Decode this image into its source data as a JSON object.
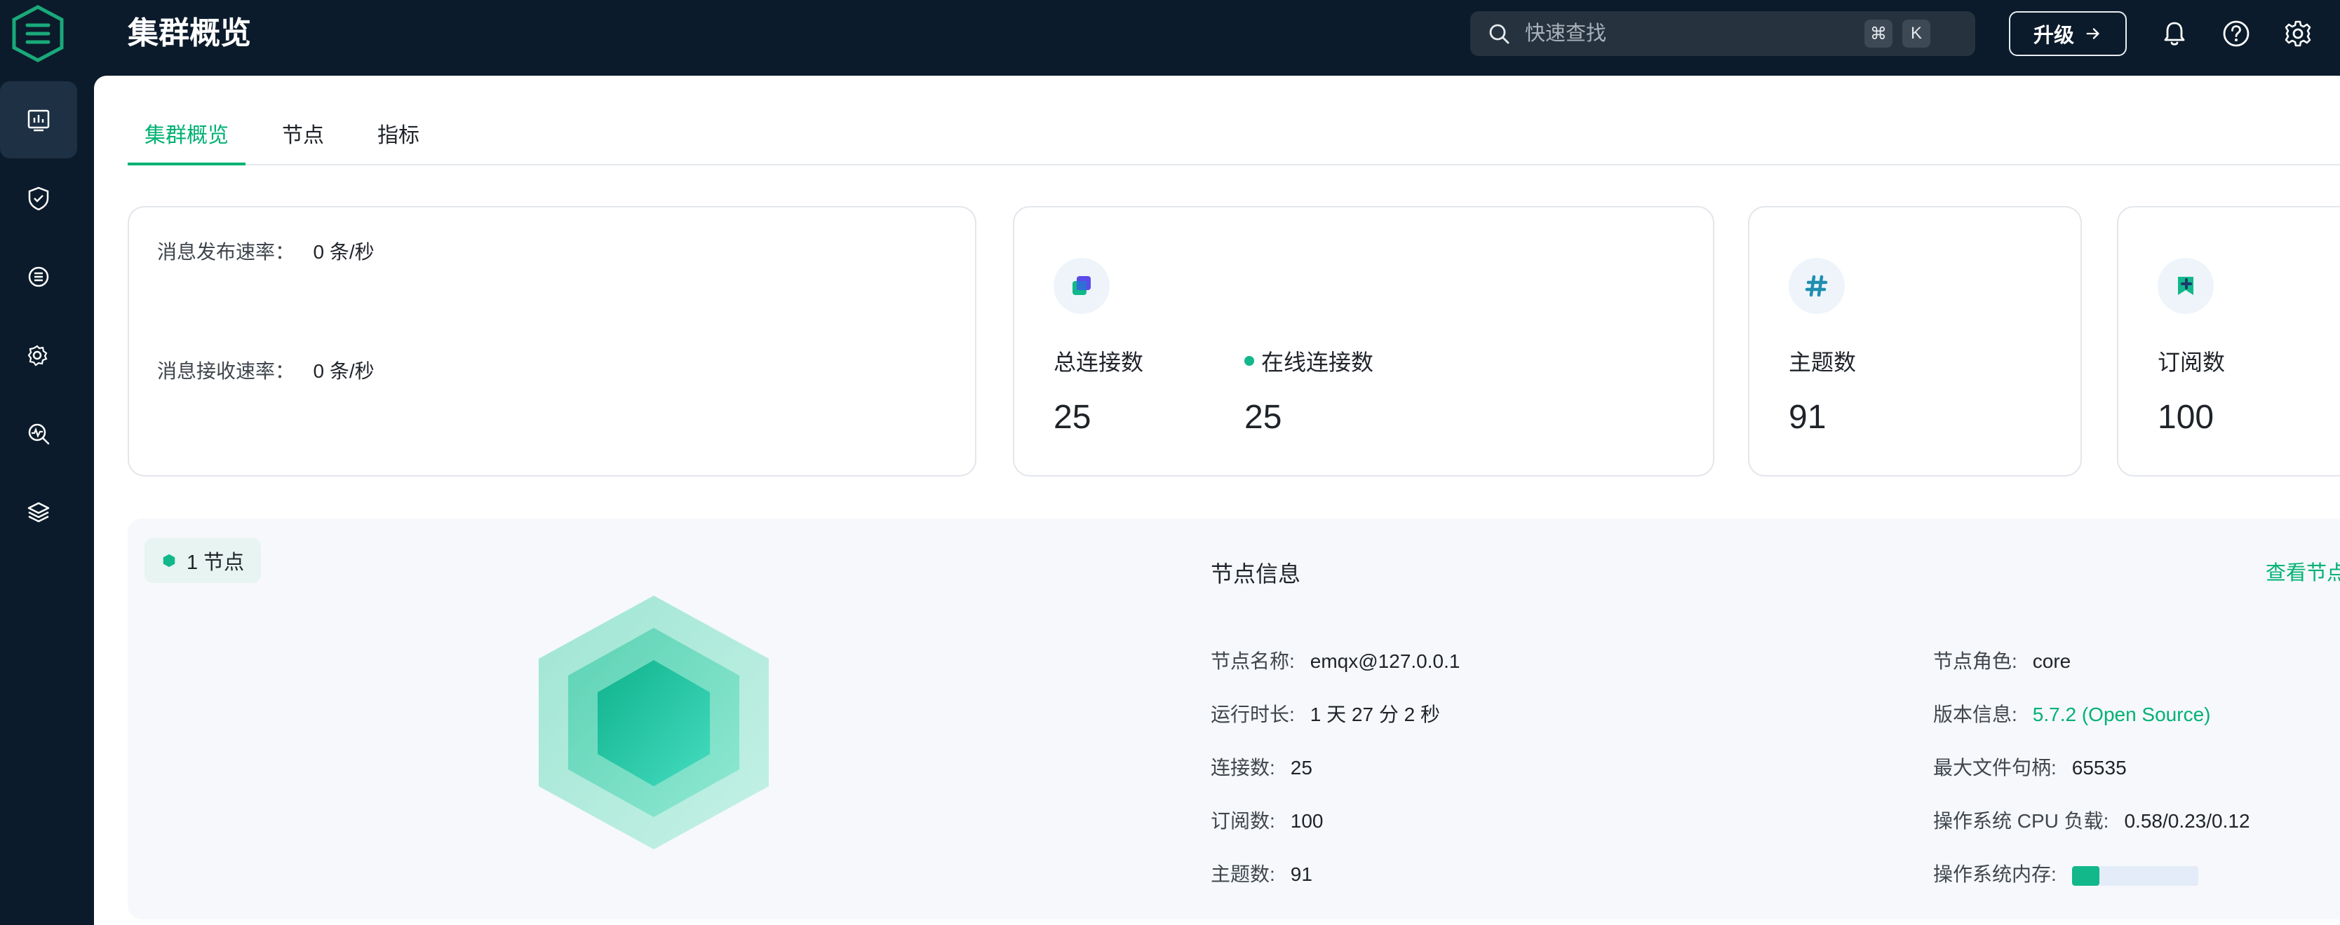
{
  "header": {
    "title": "集群概览",
    "search_placeholder": "快速查找",
    "shortcut_cmd": "⌘",
    "shortcut_key": "K",
    "upgrade_label": "升级"
  },
  "sidebar": {
    "items": [
      {
        "icon": "dashboard-icon",
        "active": true
      },
      {
        "icon": "shield-icon",
        "active": false
      },
      {
        "icon": "integration-icon",
        "active": false
      },
      {
        "icon": "settings-gear-icon",
        "active": false
      },
      {
        "icon": "diagnose-icon",
        "active": false
      },
      {
        "icon": "layers-icon",
        "active": false
      }
    ]
  },
  "tabs": [
    {
      "label": "集群概览",
      "active": true
    },
    {
      "label": "节点",
      "active": false
    },
    {
      "label": "指标",
      "active": false
    }
  ],
  "rates": {
    "publish_label": "消息发布速率：",
    "publish_value": "0 条/秒",
    "receive_label": "消息接收速率：",
    "receive_value": "0 条/秒"
  },
  "connections": {
    "total_label": "总连接数",
    "total_value": "25",
    "online_label": "在线连接数",
    "online_value": "25"
  },
  "topics": {
    "label": "主题数",
    "value": "91"
  },
  "subscriptions": {
    "label": "订阅数",
    "value": "100"
  },
  "node": {
    "badge": "1 节点",
    "info_title": "节点信息",
    "view_link": "查看节点",
    "left": [
      {
        "k": "节点名称:",
        "v": "emqx@127.0.0.1"
      },
      {
        "k": "运行时长:",
        "v": "1 天 27 分 2 秒"
      },
      {
        "k": "连接数:",
        "v": "25"
      },
      {
        "k": "订阅数:",
        "v": "100"
      },
      {
        "k": "主题数:",
        "v": "91"
      }
    ],
    "right": [
      {
        "k": "节点角色:",
        "v": "core"
      },
      {
        "k": "版本信息:",
        "v": "5.7.2 (Open Source)"
      },
      {
        "k": "最大文件句柄:",
        "v": "65535"
      },
      {
        "k": "操作系统 CPU 负载:",
        "v": "0.58/0.23/0.12"
      },
      {
        "k": "操作系统内存:",
        "v": ""
      }
    ],
    "memory_used_fraction": 0.22
  },
  "colors": {
    "accent": "#00b173",
    "sidebar_bg": "#0b1b2b"
  }
}
